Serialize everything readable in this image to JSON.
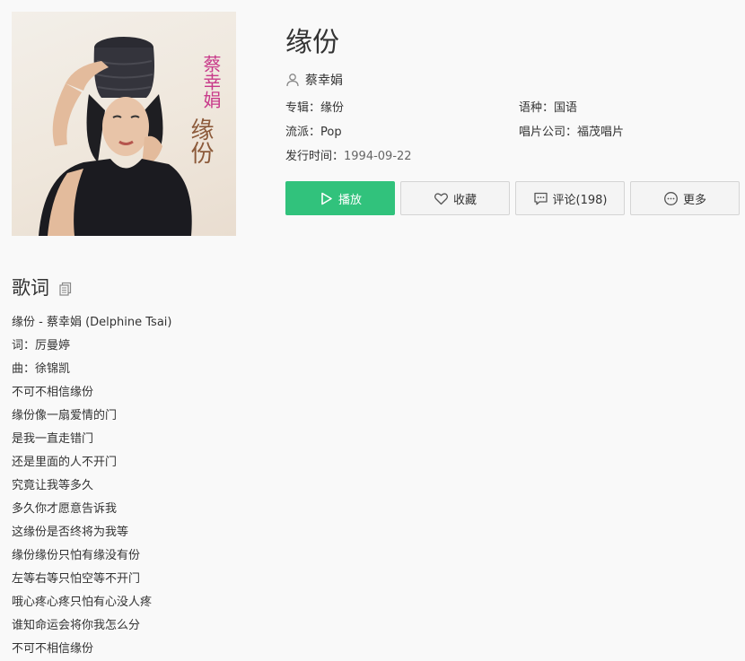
{
  "album_cover": {
    "artist_text": "蔡幸娟",
    "title_text": "缘份"
  },
  "song": {
    "title": "缘份",
    "artist": "蔡幸娟"
  },
  "meta": {
    "album": {
      "label": "专辑：",
      "value": "缘份"
    },
    "language": {
      "label": "语种：",
      "value": "国语"
    },
    "genre": {
      "label": "流派：",
      "value": "Pop"
    },
    "label_company": {
      "label": "唱片公司：",
      "value": "福茂唱片"
    },
    "release": {
      "label": "发行时间：",
      "value": "1994-09-22"
    }
  },
  "buttons": {
    "play": {
      "label": "播放",
      "icon": "play-icon"
    },
    "favorite": {
      "label": "收藏",
      "icon": "heart-icon"
    },
    "comment": {
      "label": "评论(198)",
      "icon": "comment-icon"
    },
    "more": {
      "label": "更多",
      "icon": "more-icon"
    }
  },
  "lyrics": {
    "heading": "歌词",
    "copy_icon": "copy-icon",
    "lines": [
      "缘份 - 蔡幸娟 (Delphine Tsai)",
      "词：厉曼婷",
      "曲：徐锦凯",
      "不可不相信缘份",
      "缘份像一扇爱情的门",
      "是我一直走错门",
      "还是里面的人不开门",
      "究竟让我等多久",
      "多久你才愿意告诉我",
      "这缘份是否终将为我等",
      "缘份缘份只怕有缘没有份",
      "左等右等只怕空等不开门",
      "哦心疼心疼只怕有心没人疼",
      "谁知命运会将你我怎么分",
      "不可不相信缘份"
    ]
  },
  "colors": {
    "primary": "#31c27c",
    "text": "#333333",
    "background": "#f9f9f9"
  }
}
